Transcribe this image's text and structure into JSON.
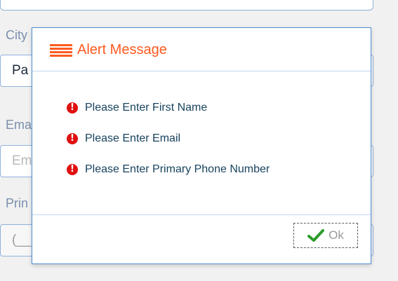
{
  "background_form": {
    "city_label": "City",
    "city_value": "Pa",
    "email_label": "Ema",
    "email_placeholder": "Em",
    "phone_label": "Prin",
    "phone_mask": "(__"
  },
  "modal": {
    "title": "Alert Message",
    "messages": [
      "Please Enter First Name",
      "Please Enter Email",
      "Please Enter Primary Phone Number"
    ],
    "ok_label": "Ok"
  },
  "colors": {
    "title_accent": "#ff5a1f",
    "error_icon": "#e01010",
    "message_text": "#18435f",
    "check_icon": "#2a9d2a",
    "modal_border": "#4f8fd1"
  },
  "icons": {
    "header": "menu-icon",
    "message": "exclamation-circle-icon",
    "ok": "check-icon"
  }
}
